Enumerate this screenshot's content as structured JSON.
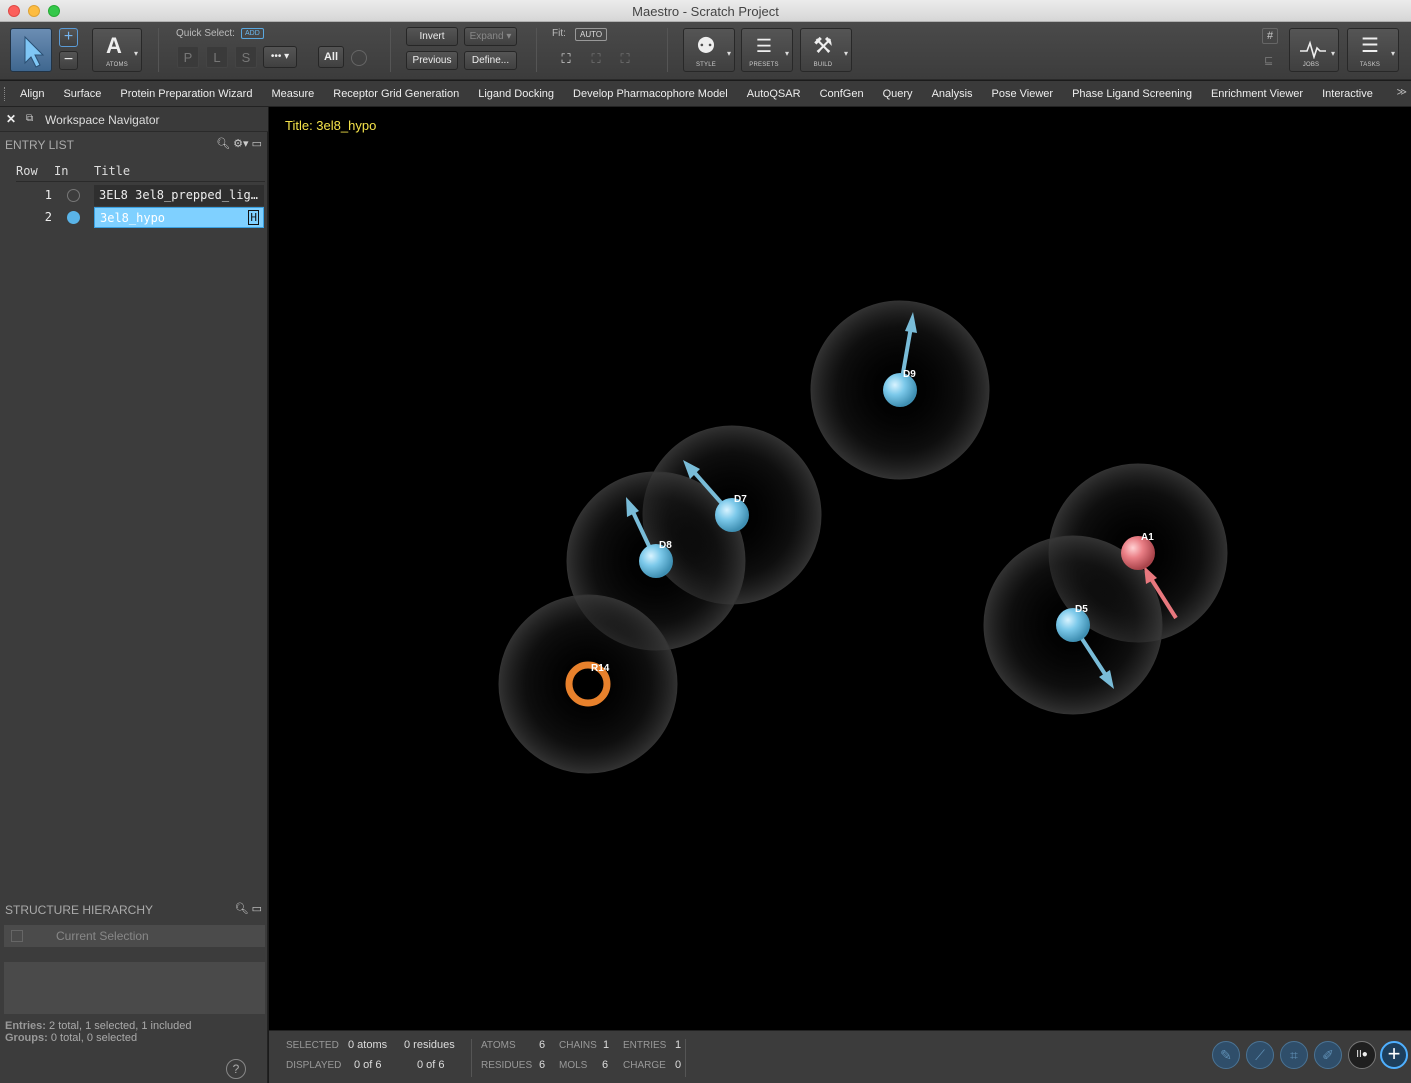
{
  "window": {
    "title": "Maestro - Scratch Project"
  },
  "toolbar": {
    "atoms_label": "ATOMS",
    "quick_select_label": "Quick Select:",
    "quick_select_add": "ADD",
    "qs_p": "P",
    "qs_l": "L",
    "qs_s": "S",
    "qs_more": "•••",
    "all_label": "All",
    "invert_label": "Invert",
    "expand_label": "Expand",
    "previous_label": "Previous",
    "define_label": "Define...",
    "fit_label": "Fit:",
    "fit_mode": "AUTO",
    "style_label": "STYLE",
    "presets_label": "PRESETS",
    "build_label": "BUILD",
    "jobs_label": "JOBS",
    "tasks_label": "TASKS"
  },
  "menu": {
    "items": [
      "Align",
      "Surface",
      "Protein Preparation Wizard",
      "Measure",
      "Receptor Grid Generation",
      "Ligand Docking",
      "Develop Pharmacophore Model",
      "AutoQSAR",
      "ConfGen",
      "Query",
      "Analysis",
      "Pose Viewer",
      "Phase Ligand Screening",
      "Enrichment Viewer",
      "Interactive"
    ],
    "more": "≫"
  },
  "navigator": {
    "title": "Workspace Navigator",
    "entry_list_label": "ENTRY LIST",
    "columns": {
      "row": "Row",
      "in": "In",
      "title": "Title"
    },
    "rows": [
      {
        "row": "1",
        "title": "3EL8 3el8_prepped_lig…",
        "included": false,
        "selected": false
      },
      {
        "row": "2",
        "title": "3el8_hypo",
        "included": true,
        "selected": true,
        "badge": "H"
      }
    ],
    "structure_label": "STRUCTURE HIERARCHY",
    "current_selection": "Current Selection",
    "summary_entries_key": "Entries:",
    "summary_entries": "2 total, 1 selected, 1 included",
    "summary_groups_key": "Groups:",
    "summary_groups": "0 total, 0 selected",
    "help": "?"
  },
  "workspace": {
    "title": "Title: 3el8_hypo",
    "features": [
      {
        "label": "D9",
        "type": "donor"
      },
      {
        "label": "D7",
        "type": "donor"
      },
      {
        "label": "D8",
        "type": "donor"
      },
      {
        "label": "R14",
        "type": "ring"
      },
      {
        "label": "A1",
        "type": "acceptor"
      },
      {
        "label": "D5",
        "type": "donor"
      }
    ],
    "colors": {
      "donor": "#6fc4e6",
      "acceptor": "#e8787e",
      "ring": "#e8812c",
      "title": "#f5e34a"
    }
  },
  "status": {
    "selected_key": "SELECTED",
    "selected_atoms": "0 atoms",
    "selected_residues": "0 residues",
    "displayed_key": "DISPLAYED",
    "displayed_atoms": "0 of 6",
    "displayed_residues": "0 of 6",
    "atoms_key": "ATOMS",
    "atoms": "6",
    "chains_key": "CHAINS",
    "chains": "1",
    "entries_key": "ENTRIES",
    "entries": "1",
    "residues_key": "RESIDUES",
    "residues": "6",
    "mols_key": "MOLS",
    "mols": "6",
    "charge_key": "CHARGE",
    "charge": "0"
  }
}
